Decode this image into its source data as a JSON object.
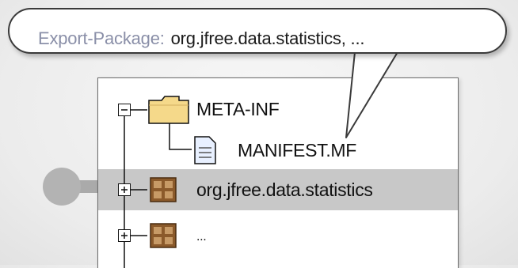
{
  "tooltip": {
    "key": "Export-Package:",
    "value": "org.jfree.data.statistics, ..."
  },
  "tree": {
    "items": [
      {
        "label": "META-INF",
        "icon": "folder-icon",
        "expand": "minus"
      },
      {
        "label": "MANIFEST.MF",
        "icon": "document-icon"
      },
      {
        "label": "org.jfree.data.statistics",
        "icon": "package-icon",
        "expand": "plus",
        "selected": true
      },
      {
        "label": "...",
        "icon": "package-icon",
        "expand": "plus"
      }
    ]
  },
  "colors": {
    "selection": "#c8c8c8",
    "folder": "#f5d98a",
    "package": "#8b5a2b",
    "connector": "#b3b3b3"
  }
}
